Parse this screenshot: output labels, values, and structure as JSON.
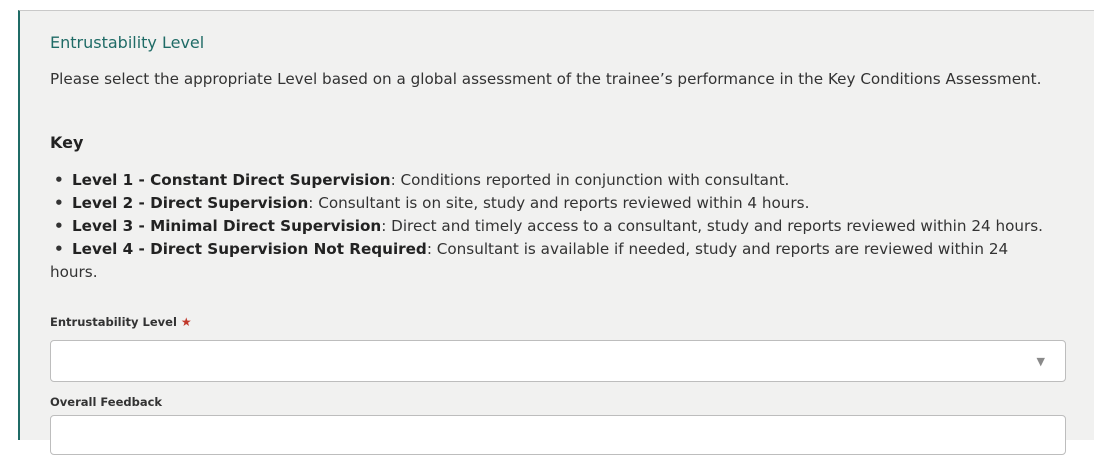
{
  "section": {
    "title": "Entrustability Level",
    "intro": "Please select the appropriate Level based on a global assessment of the trainee’s performance in the Key Conditions Assessment."
  },
  "key": {
    "heading": "Key",
    "items": [
      {
        "level": "Level 1 - Constant Direct Supervision",
        "desc": ": Conditions reported in conjunction with consultant."
      },
      {
        "level": "Level 2 - Direct Supervision",
        "desc": ": Consultant is on site, study and reports reviewed within 4 hours."
      },
      {
        "level": "Level 3 - Minimal Direct Supervision",
        "desc": ": Direct and timely access to a consultant, study and reports reviewed within 24 hours."
      },
      {
        "level": "Level 4 - Direct Supervision Not Required",
        "desc": ": Consultant is available if needed, study and reports are reviewed within 24 hours."
      }
    ]
  },
  "form": {
    "entrustability_label": "Entrustability Level",
    "required_marker": "★",
    "entrustability_value": "",
    "caret": "▼",
    "feedback_label": "Overall Feedback",
    "feedback_value": ""
  }
}
